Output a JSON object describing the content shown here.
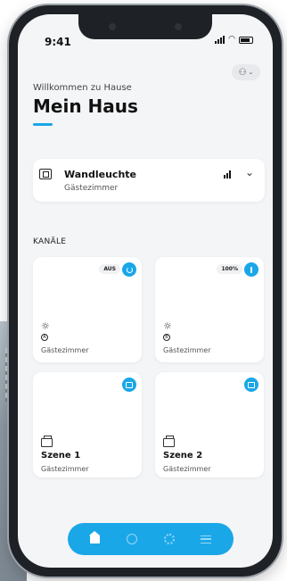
{
  "status": {
    "time": "9:41"
  },
  "header": {
    "welcome": "Willkommen zu Hause",
    "title": "Mein Haus"
  },
  "device": {
    "name": "Wandleuchte",
    "room": "Gästezimmer",
    "icon": "device-panel-icon"
  },
  "channels": {
    "section_label": "KANÄLE",
    "tiles": [
      {
        "badge": "AUS",
        "room": "Gästezimmer",
        "icon": "bulb-icon",
        "action_icon": "power-icon"
      },
      {
        "badge": "100%",
        "room": "Gästezimmer",
        "icon": "bulb-icon",
        "action_icon": "info-icon"
      },
      {
        "name": "Szene 1",
        "room": "Gästezimmer",
        "icon": "scene-icon",
        "action_icon": "scene-icon"
      },
      {
        "name": "Szene 2",
        "room": "Gästezimmer",
        "icon": "scene-icon",
        "action_icon": "scene-icon"
      }
    ]
  },
  "nav": {
    "items": [
      "home-icon",
      "clock-icon",
      "gear-icon",
      "menu-icon"
    ],
    "active": "home-icon"
  },
  "colors": {
    "accent": "#1aa7e8",
    "background": "#f4f5f7",
    "card": "#ffffff"
  }
}
